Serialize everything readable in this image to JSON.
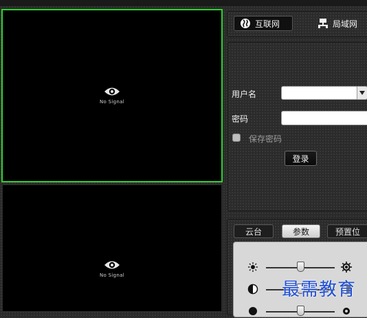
{
  "video": {
    "panel1": {
      "status": "No Signal"
    },
    "panel2": {
      "status": "No Signal"
    }
  },
  "network": {
    "internet_label": "互联网",
    "lan_label": "局域网",
    "icons": {
      "internet": "globe-icon",
      "lan": "network-icon"
    }
  },
  "login": {
    "username_label": "用户名",
    "username_value": "",
    "password_label": "密码",
    "password_value": "",
    "remember_label": "保存密码",
    "remember_checked": false,
    "login_button": "登录"
  },
  "control": {
    "tabs": [
      {
        "label": "云台",
        "active": false
      },
      {
        "label": "参数",
        "active": true
      },
      {
        "label": "预置位",
        "active": false
      }
    ],
    "sliders": [
      {
        "name": "brightness",
        "left_icon": "sun-small-icon",
        "right_icon": "sun-large-icon",
        "value": 0.5
      },
      {
        "name": "contrast",
        "left_icon": "contrast-icon",
        "right_icon": "contrast-icon",
        "value": 0.5
      },
      {
        "name": "saturation",
        "left_icon": "saturation-icon",
        "right_icon": "gear-icon",
        "value": 0.5
      }
    ]
  },
  "watermark": {
    "text": "最需教育"
  },
  "colors": {
    "active_border": "#2fd22f",
    "watermark": "#1f4fd6"
  }
}
